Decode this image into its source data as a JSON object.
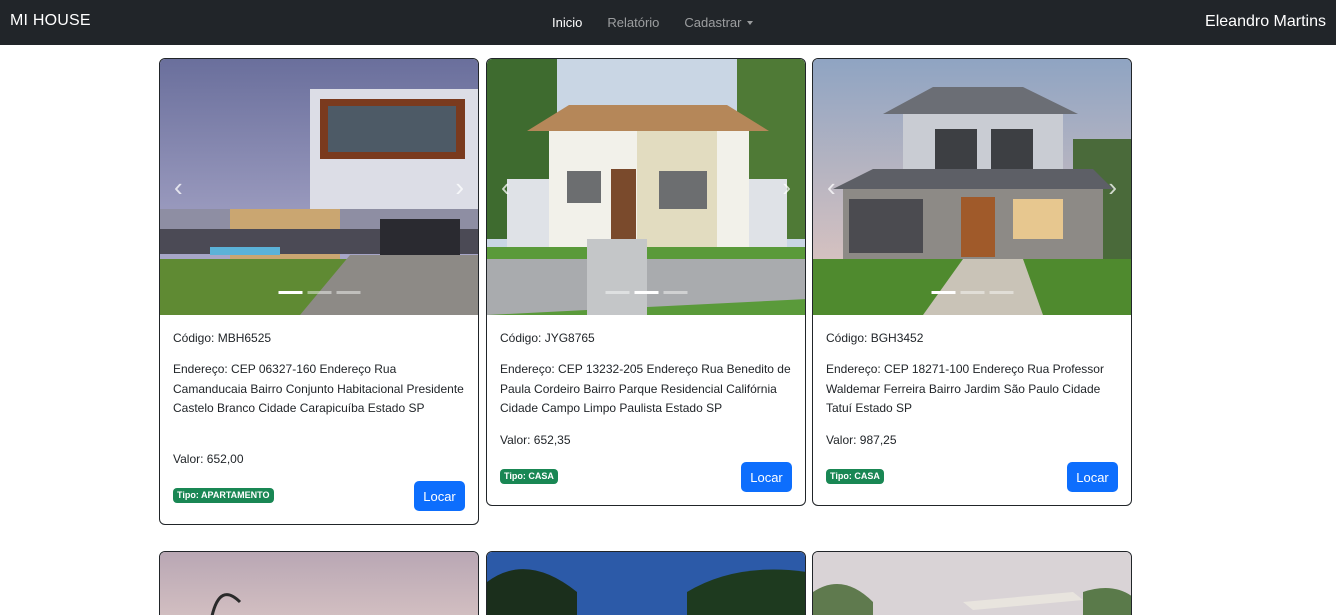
{
  "navbar": {
    "brand": "MI HOUSE",
    "links": [
      "Inicio",
      "Relatório",
      "Cadastrar"
    ],
    "user": "Eleandro Martins"
  },
  "cards": [
    {
      "codigo": "Código: MBH6525",
      "endereco": "Endereço: CEP 06327-160 Endereço Rua Camanducaia Bairro Conjunto Habitacional Presidente Castelo Branco Cidade Carapicuíba Estado SP",
      "valor": "Valor: 652,00",
      "tipo": "Tipo: APARTAMENTO",
      "button": "Locar",
      "active_slide": 0
    },
    {
      "codigo": "Código: JYG8765",
      "endereco": "Endereço: CEP 13232-205 Endereço Rua Benedito de Paula Cordeiro Bairro Parque Residencial Califórnia Cidade Campo Limpo Paulista Estado SP",
      "valor": "Valor: 652,35",
      "tipo": "Tipo: CASA",
      "button": "Locar",
      "active_slide": 1
    },
    {
      "codigo": "Código: BGH3452",
      "endereco": "Endereço: CEP 18271-100 Endereço Rua Professor Waldemar Ferreira Bairro Jardim São Paulo Cidade Tatuí Estado SP",
      "valor": "Valor: 987,25",
      "tipo": "Tipo: CASA",
      "button": "Locar",
      "active_slide": 0
    }
  ],
  "colors": {
    "navbar_bg": "#212529",
    "primary": "#0d6efd",
    "badge_success": "#198754"
  }
}
